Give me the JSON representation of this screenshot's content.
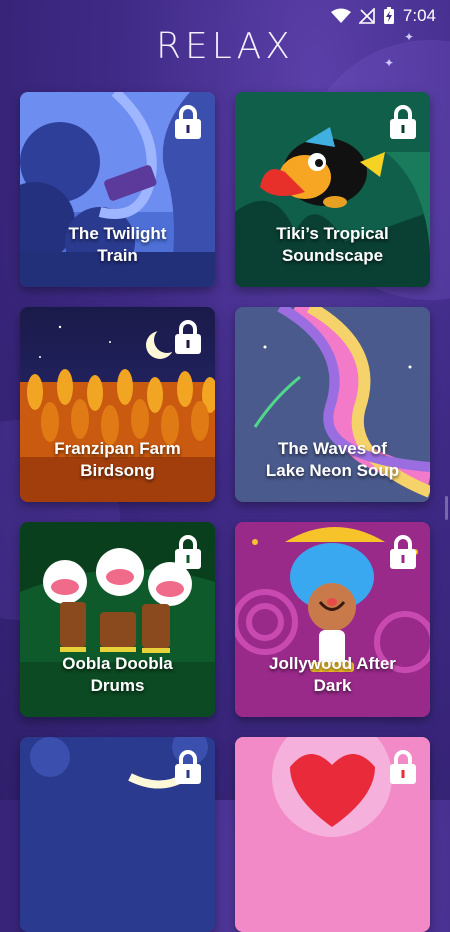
{
  "status_bar": {
    "time": "7:04"
  },
  "header": {
    "title": "RELAX"
  },
  "cards": [
    {
      "title_line1": "The Twilight",
      "title_line2": "Train",
      "locked": true
    },
    {
      "title_line1": "Tiki’s Tropical",
      "title_line2": "Soundscape",
      "locked": true
    },
    {
      "title_line1": "Franzipan Farm",
      "title_line2": "Birdsong",
      "locked": true
    },
    {
      "title_line1": "The Waves of",
      "title_line2": "Lake Neon Soup",
      "locked": false
    },
    {
      "title_line1": "Oobla Doobla",
      "title_line2": "Drums",
      "locked": true
    },
    {
      "title_line1": "Jollywood After",
      "title_line2": "Dark",
      "locked": true
    },
    {
      "title_line1": "",
      "title_line2": "",
      "locked": true
    },
    {
      "title_line1": "",
      "title_line2": "",
      "locked": true
    }
  ],
  "icons": {
    "wifi": "wifi-icon",
    "signal": "no-signal-icon",
    "battery": "battery-charging-icon",
    "lock": "lock-icon"
  },
  "colors": {
    "background": "#3f2a86",
    "title": "#f4f0ff"
  }
}
